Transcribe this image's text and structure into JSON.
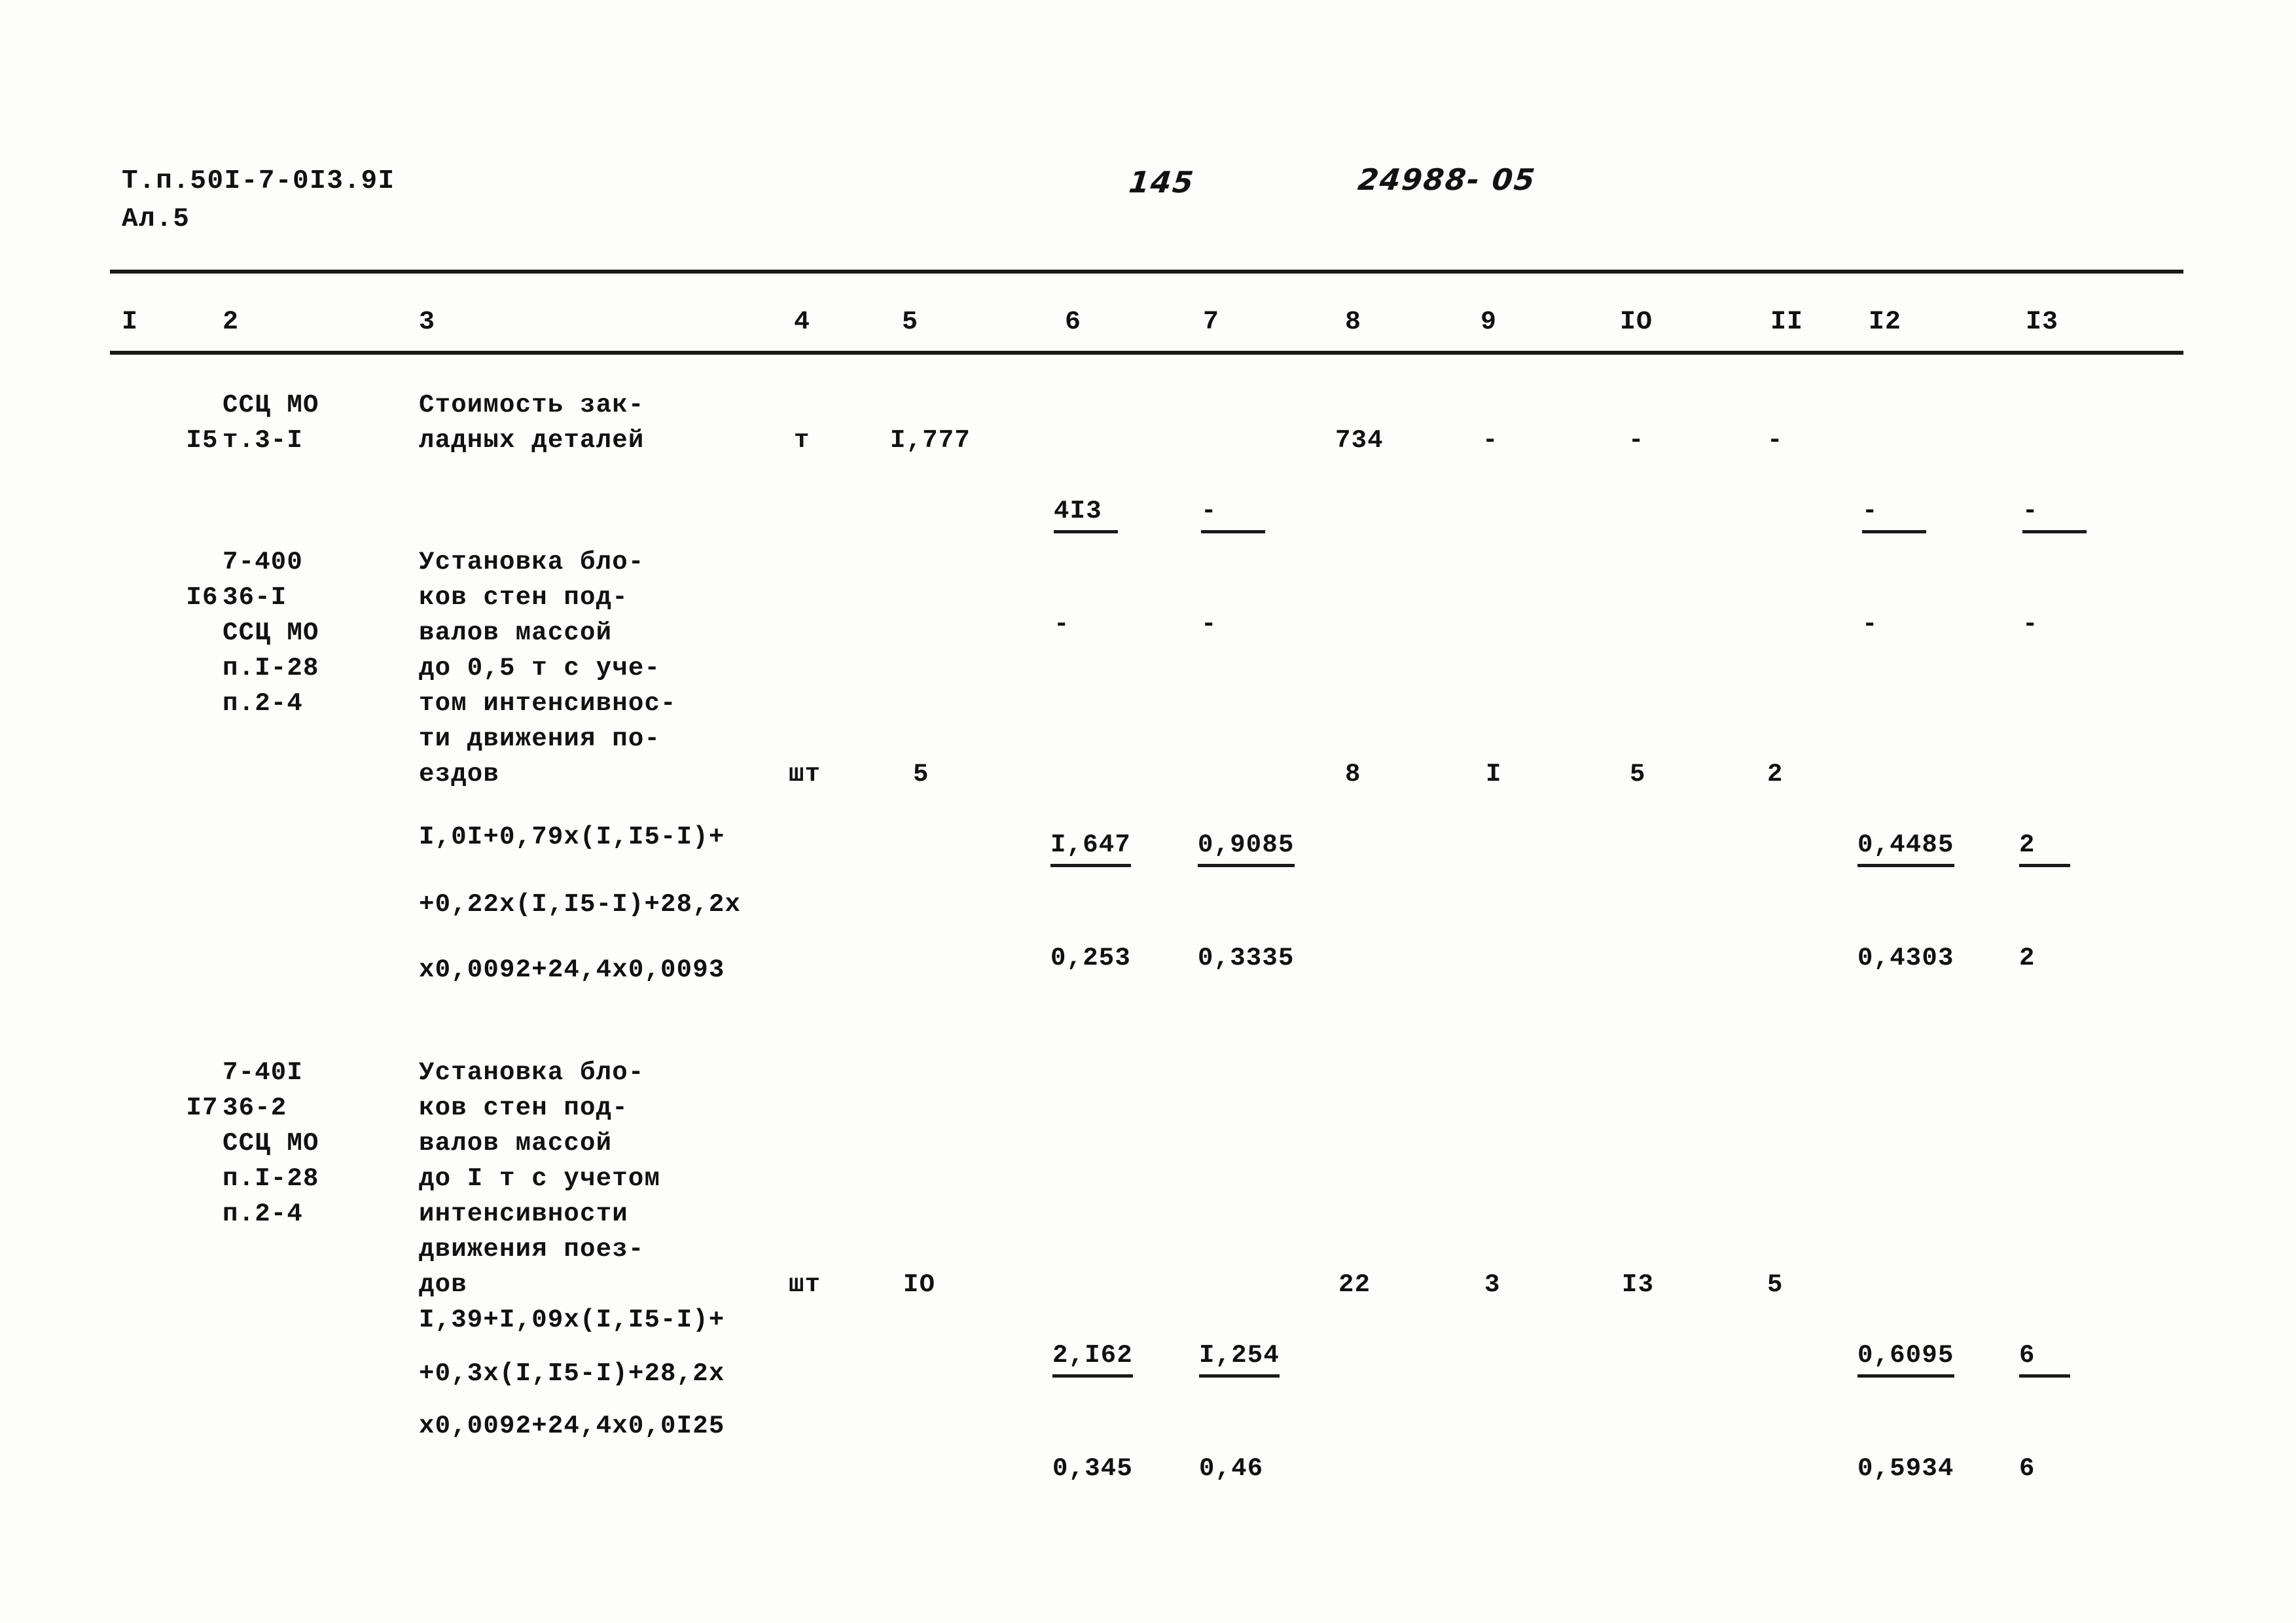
{
  "header": {
    "doc_code_line1": "Т.п.50I-7-0I3.9I",
    "doc_code_line2": "Ал.5",
    "hand_page_number": "145",
    "hand_doc_number": "24988- 05"
  },
  "table": {
    "column_headers": [
      "I",
      "2",
      "3",
      "4",
      "5",
      "6",
      "7",
      "8",
      "9",
      "IO",
      "II",
      "I2",
      "I3"
    ],
    "rows": [
      {
        "no": "I5",
        "code_lines": [
          "ССЦ МО",
          "т.3-I"
        ],
        "desc_lines": [
          "Стоимость зак-",
          "ладных деталей"
        ],
        "unit": "т",
        "qty": "I,777",
        "c6_top": "4I3",
        "c6_bot": "-",
        "c7_top": "-",
        "c7_bot": "-",
        "c8": "734",
        "c9": "-",
        "c10": "-",
        "c11": "-",
        "c12_top": "-",
        "c12_bot": "-",
        "c13_top": "-",
        "c13_bot": "-",
        "formula_lines": []
      },
      {
        "no": "I6",
        "code_lines": [
          "7-400",
          "36-I",
          "ССЦ МО",
          "п.I-28",
          "п.2-4"
        ],
        "desc_lines": [
          "Установка бло-",
          "ков стен под-",
          "валов массой",
          "до 0,5 т с уче-",
          "том интенсивнос-",
          "ти движения по-",
          "ездов"
        ],
        "unit": "шт",
        "qty": "5",
        "c6_top": "I,647",
        "c6_bot": "0,253",
        "c7_top": "0,9085",
        "c7_bot": "0,3335",
        "c8": "8",
        "c9": "I",
        "c10": "5",
        "c11": "2",
        "c12_top": "0,4485",
        "c12_bot": "0,4303",
        "c13_top": "2",
        "c13_bot": "2",
        "formula_lines": [
          "I,0I+0,79x(I,I5-I)+",
          "+0,22x(I,I5-I)+28,2x",
          "x0,0092+24,4x0,0093"
        ]
      },
      {
        "no": "I7",
        "code_lines": [
          "7-40I",
          "36-2",
          "ССЦ МО",
          "п.I-28",
          "п.2-4"
        ],
        "desc_lines": [
          "Установка бло-",
          "ков стен под-",
          "валов массой",
          "до I т с учетом",
          "интенсивности",
          "движения поез-",
          "дов"
        ],
        "unit": "шт",
        "qty": "IO",
        "c6_top": "2,I62",
        "c6_bot": "0,345",
        "c7_top": "I,254",
        "c7_bot": "0,46",
        "c8": "22",
        "c9": "3",
        "c10": "I3",
        "c11": "5",
        "c12_top": "0,6095",
        "c12_bot": "0,5934",
        "c13_top": "6",
        "c13_bot": "6",
        "formula_lines": [
          "I,39+I,09x(I,I5-I)+",
          "+0,3x(I,I5-I)+28,2x",
          "x0,0092+24,4x0,0I25"
        ]
      }
    ]
  }
}
